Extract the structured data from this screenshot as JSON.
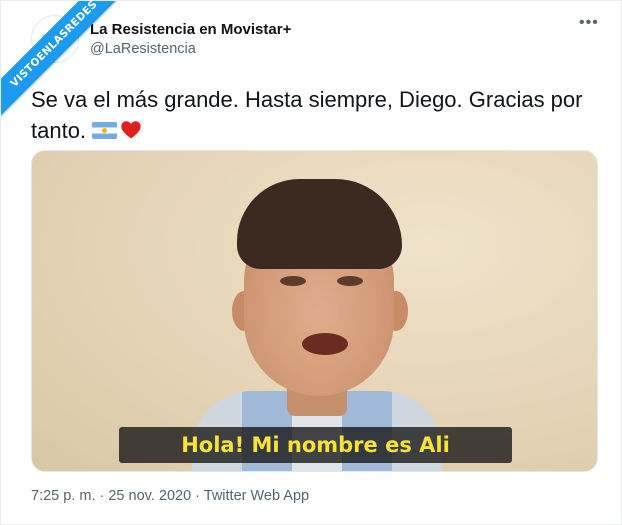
{
  "ribbon": {
    "text": "VISTOENLASREDES"
  },
  "author": {
    "name": "La Resistencia en Movistar+",
    "handle": "@LaResistencia"
  },
  "tweet": {
    "text": "Se va el más grande. Hasta siempre, Diego. Gracias por tanto.",
    "emojis": [
      "flag-argentina-icon",
      "red-heart-icon"
    ]
  },
  "media": {
    "subtitle": "Hola! Mi nombre es Ali"
  },
  "meta": {
    "timestamp": "7:25 p. m. · 25 nov. 2020 · Twitter Web App"
  },
  "colors": {
    "accent": "#1d9bf0",
    "subtitle": "#f7e23a",
    "secondary_text": "#536471"
  }
}
